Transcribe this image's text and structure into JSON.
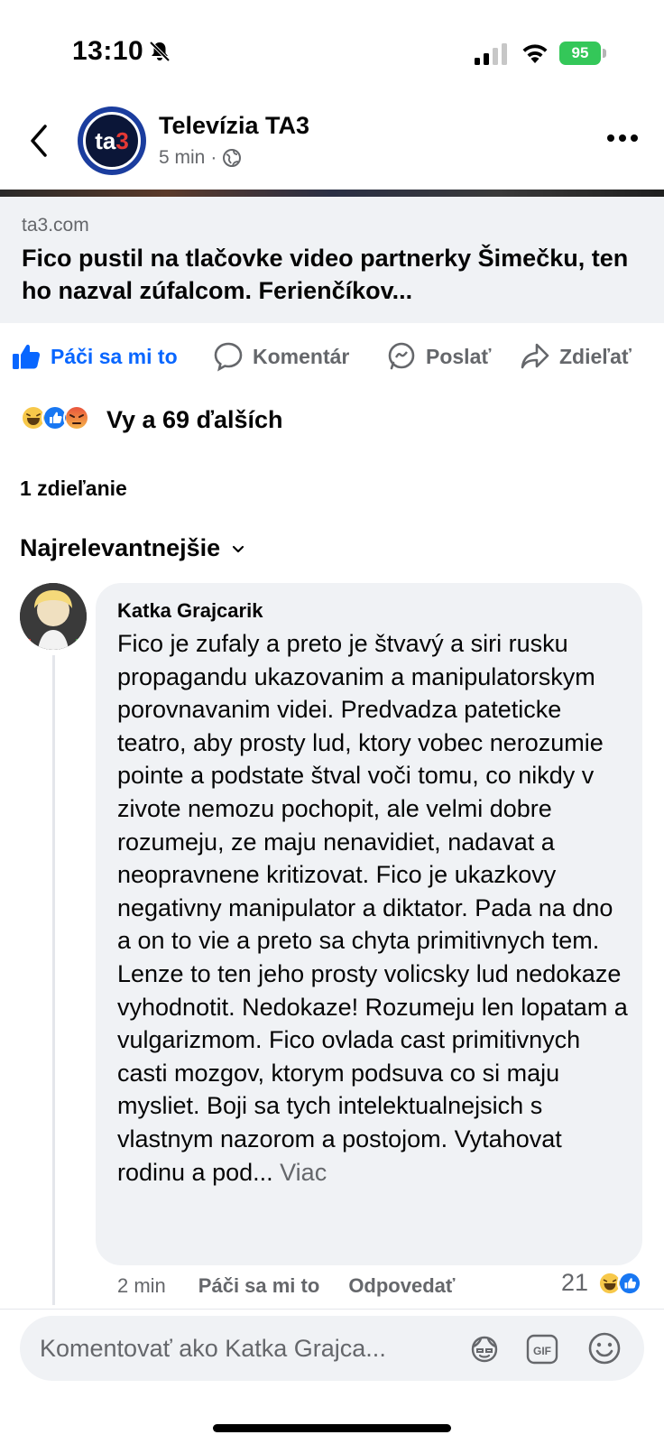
{
  "status": {
    "time": "13:10",
    "battery": "95"
  },
  "post": {
    "page_name": "Televízia TA3",
    "time": "5 min",
    "separator": "·",
    "avatar_text": {
      "a": "ta",
      "b": "3"
    },
    "link": {
      "domain": "ta3.com",
      "title": "Fico pustil na tlačovke video partnerky Šimečku, ten ho nazval zúfalcom. Ferienčíkov..."
    },
    "actions": {
      "like": "Páči sa mi to",
      "comment": "Komentár",
      "send": "Poslať",
      "share": "Zdieľať"
    },
    "reactions_text": "Vy a 69 ďalších",
    "shares_text": "1 zdieľanie",
    "sort_label": "Najrelevantnejšie"
  },
  "comment": {
    "author": "Katka Grajcarik",
    "body": "Fico je zufaly a preto je štvavý a siri rusku propagandu ukazovanim a manipulatorskym porovnavanim videi. Predvadza pateticke teatro, aby prosty lud, ktory vobec nerozumie pointe a podstate štval voči tomu, co nikdy v zivote nemozu pochopit, ale velmi dobre rozumeju, ze maju nenavidiet, nadavat a neopravnene  kritizovat. Fico je ukazkovy negativny manipulator a diktator. Pada na dno a on to vie a preto sa chyta primitivnych tem. Lenze to ten jeho prosty volicsky lud nedokaze vyhodnotit. Nedokaze! Rozumeju len lopatam a vulgarizmom. Fico ovlada cast primitivnych casti mozgov, ktorym podsuva co si maju mysliet. Boji sa tych intelektualnejsich s vlastnym nazorom a postojom. Vytahovat rodinu a pod...",
    "more": "Viac",
    "time": "2 min",
    "like": "Páči sa mi to",
    "reply": "Odpovedať",
    "reaction_count": "21"
  },
  "composer": {
    "placeholder": "Komentovať ako Katka Grajca...",
    "gif": "GIF"
  },
  "colors": {
    "facebook_blue": "#0866ff",
    "secondary_text": "#65676b",
    "bubble_bg": "#f0f2f5",
    "battery_green": "#34c759"
  },
  "icons": [
    "bell-slash-icon",
    "signal-icon",
    "wifi-icon",
    "back-icon",
    "globe-icon",
    "more-icon",
    "thumbs-up-icon",
    "comment-icon",
    "messenger-icon",
    "share-icon",
    "haha-icon",
    "like-icon",
    "angry-icon",
    "chevron-down-icon",
    "avatar-sticker-icon",
    "gif-icon",
    "emoji-icon"
  ]
}
